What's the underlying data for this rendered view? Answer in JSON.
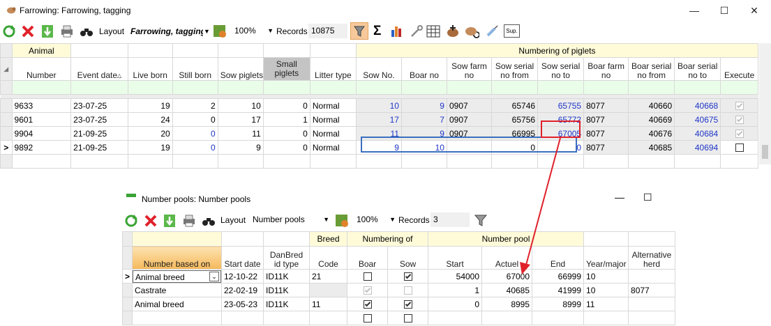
{
  "win1": {
    "title": "Farrowing: Farrowing, tagging",
    "toolbar": {
      "layout_label": "Layout",
      "layout_value": "Farrowing, tagging",
      "zoom": "100%",
      "records_label": "Records",
      "records_value": "10875"
    },
    "groups": {
      "animal": "Animal",
      "numbering": "Numbering of piglets"
    },
    "columns": [
      "Number",
      "Event date",
      "Live born",
      "Still born",
      "Sow piglets",
      "Small piglets",
      "Litter type",
      "Sow No.",
      "Boar no",
      "Sow farm no",
      "Sow serial no from",
      "Sow serial no to",
      "Boar farm no",
      "Boar serial no from",
      "Boar serial no to",
      "Execute"
    ],
    "rows": [
      {
        "number": "9633",
        "date": "23-07-25",
        "live": "19",
        "still": "2",
        "sow": "10",
        "small": "0",
        "litter": "Normal",
        "sowno": "10",
        "boarno": "9",
        "sowfarm": "0907",
        "from": "65746",
        "to": "65755",
        "boarfarm": "8077",
        "bfrom": "40660",
        "bto": "40668",
        "exec": true
      },
      {
        "number": "9601",
        "date": "23-07-25",
        "live": "24",
        "still": "0",
        "sow": "17",
        "small": "1",
        "litter": "Normal",
        "sowno": "17",
        "boarno": "7",
        "sowfarm": "0907",
        "from": "65756",
        "to": "65772",
        "boarfarm": "8077",
        "bfrom": "40669",
        "bto": "40675",
        "exec": true
      },
      {
        "number": "9904",
        "date": "21-09-25",
        "live": "20",
        "still": "0",
        "sow": "11",
        "small": "0",
        "litter": "Normal",
        "sowno": "11",
        "boarno": "9",
        "sowfarm": "0907",
        "from": "66995",
        "to": "67005",
        "boarfarm": "8077",
        "bfrom": "40676",
        "bto": "40684",
        "exec": true
      },
      {
        "number": "9892",
        "date": "21-09-25",
        "live": "19",
        "still": "0",
        "sow": "9",
        "small": "0",
        "litter": "Normal",
        "sowno": "9",
        "boarno": "10",
        "sowfarm": "",
        "from": "0",
        "to": "0",
        "boarfarm": "8077",
        "bfrom": "40685",
        "bto": "40694",
        "exec": false
      }
    ],
    "current_row_marker": ">"
  },
  "win2": {
    "title": "Number pools: Number pools",
    "toolbar": {
      "layout_label": "Layout",
      "layout_value": "Number pools",
      "zoom": "100%",
      "records_label": "Records",
      "records_value": "3"
    },
    "groups": {
      "breed": "Breed",
      "numbering": "Numbering of",
      "pool": "Number pool"
    },
    "columns": [
      "Number based on",
      "Start date",
      "DanBred id type",
      "Code",
      "Boar",
      "Sow",
      "Start",
      "Actuel",
      "End",
      "Year/major",
      "Alternative herd"
    ],
    "rows": [
      {
        "based": "Animal breed",
        "start": "12-10-22",
        "idtype": "ID11K",
        "code": "21",
        "boar": false,
        "sow": true,
        "pstart": "54000",
        "actuel": "67000",
        "end": "66999",
        "year": "10",
        "alt": ""
      },
      {
        "based": "Castrate",
        "start": "22-02-19",
        "idtype": "ID11K",
        "code": "",
        "boar": true,
        "sow": false,
        "pstart": "1",
        "actuel": "40685",
        "end": "41999",
        "year": "10",
        "alt": "8077"
      },
      {
        "based": "Animal breed",
        "start": "23-05-23",
        "idtype": "ID11K",
        "code": "11",
        "boar": true,
        "sow": true,
        "pstart": "0",
        "actuel": "8995",
        "end": "8999",
        "year": "11",
        "alt": ""
      }
    ],
    "current_row_marker": ">"
  },
  "colors": {
    "highlight_blue": "#3b6fbf",
    "highlight_red": "#e0212a",
    "link_blue": "#1f35c8",
    "group_yellow": "#fffbd9",
    "filter_green": "#eafde9"
  }
}
